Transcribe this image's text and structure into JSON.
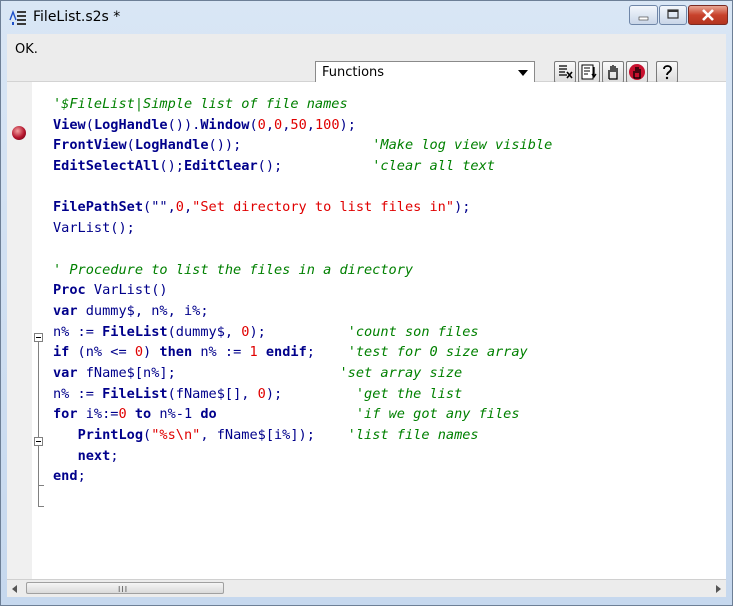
{
  "window": {
    "title": "FileList.s2s *",
    "app_icon": "script-document-icon",
    "controls": [
      "minimize-icon",
      "maximize-icon",
      "close-icon"
    ]
  },
  "toolbar": {
    "status": "OK.",
    "combo_value": "Functions",
    "tools": [
      "syntax-check-icon",
      "run-list-icon",
      "stop-hand-icon",
      "breakpoint-hand-icon",
      "help-icon"
    ]
  },
  "editor": {
    "breakpoint_line": 2,
    "lines": [
      [
        [
          "cmt",
          "'$FileList|Simple list of file names"
        ]
      ],
      [
        [
          "fn",
          "View"
        ],
        [
          "txt",
          "("
        ],
        [
          "fn",
          "LogHandle"
        ],
        [
          "txt",
          "())."
        ],
        [
          "fn",
          "Window"
        ],
        [
          "txt",
          "("
        ],
        [
          "num",
          "0"
        ],
        [
          "txt",
          ","
        ],
        [
          "num",
          "0"
        ],
        [
          "txt",
          ","
        ],
        [
          "num",
          "50"
        ],
        [
          "txt",
          ","
        ],
        [
          "num",
          "100"
        ],
        [
          "txt",
          ");"
        ]
      ],
      [
        [
          "fn",
          "FrontView"
        ],
        [
          "txt",
          "("
        ],
        [
          "fn",
          "LogHandle"
        ],
        [
          "txt",
          "());                "
        ],
        [
          "cmt",
          "'Make log view visible"
        ]
      ],
      [
        [
          "fn",
          "EditSelectAll"
        ],
        [
          "txt",
          "();"
        ],
        [
          "fn",
          "EditClear"
        ],
        [
          "txt",
          "();           "
        ],
        [
          "cmt",
          "'clear all text"
        ]
      ],
      [],
      [
        [
          "fn",
          "FilePathSet"
        ],
        [
          "txt",
          "(\"\","
        ],
        [
          "num",
          "0"
        ],
        [
          "txt",
          ","
        ],
        [
          "str",
          "\"Set directory to list files in\""
        ],
        [
          "txt",
          ");"
        ]
      ],
      [
        [
          "txt",
          "VarList();"
        ]
      ],
      [],
      [
        [
          "cmt",
          "' Procedure to list the files in a directory"
        ]
      ],
      [
        [
          "kw",
          "Proc"
        ],
        [
          "txt",
          " VarList()"
        ]
      ],
      [
        [
          "kw",
          "var"
        ],
        [
          "txt",
          " dummy$, n%, i%;"
        ]
      ],
      [
        [
          "txt",
          "n% := "
        ],
        [
          "fn",
          "FileList"
        ],
        [
          "txt",
          "(dummy$, "
        ],
        [
          "num",
          "0"
        ],
        [
          "txt",
          ");          "
        ],
        [
          "cmt",
          "'count son files"
        ]
      ],
      [
        [
          "kw",
          "if"
        ],
        [
          "txt",
          " (n% <= "
        ],
        [
          "num",
          "0"
        ],
        [
          "txt",
          ") "
        ],
        [
          "kw",
          "then"
        ],
        [
          "txt",
          " n% := "
        ],
        [
          "num",
          "1"
        ],
        [
          "txt",
          " "
        ],
        [
          "kw",
          "endif"
        ],
        [
          "txt",
          ";    "
        ],
        [
          "cmt",
          "'test for 0 size array"
        ]
      ],
      [
        [
          "kw",
          "var"
        ],
        [
          "txt",
          " fName$[n%];                    "
        ],
        [
          "cmt",
          "'set array size"
        ]
      ],
      [
        [
          "txt",
          "n% := "
        ],
        [
          "fn",
          "FileList"
        ],
        [
          "txt",
          "(fName$[], "
        ],
        [
          "num",
          "0"
        ],
        [
          "txt",
          ");         "
        ],
        [
          "cmt",
          "'get the list"
        ]
      ],
      [
        [
          "kw",
          "for"
        ],
        [
          "txt",
          " i%:="
        ],
        [
          "num",
          "0"
        ],
        [
          "txt",
          " "
        ],
        [
          "kw",
          "to"
        ],
        [
          "txt",
          " n%-1 "
        ],
        [
          "kw",
          "do"
        ],
        [
          "txt",
          "                 "
        ],
        [
          "cmt",
          "'if we got any files"
        ]
      ],
      [
        [
          "txt",
          "   "
        ],
        [
          "fn",
          "PrintLog"
        ],
        [
          "txt",
          "("
        ],
        [
          "str",
          "\"%s\\n\""
        ],
        [
          "txt",
          ", fName$[i%]);    "
        ],
        [
          "cmt",
          "'list file names"
        ]
      ],
      [
        [
          "txt",
          "   "
        ],
        [
          "kw",
          "next"
        ],
        [
          "txt",
          ";"
        ]
      ],
      [
        [
          "kw",
          "end"
        ],
        [
          "txt",
          ";"
        ]
      ]
    ]
  },
  "scrollbar": {
    "left_icon": "scroll-left-icon",
    "right_icon": "scroll-right-icon",
    "grip": "III"
  }
}
